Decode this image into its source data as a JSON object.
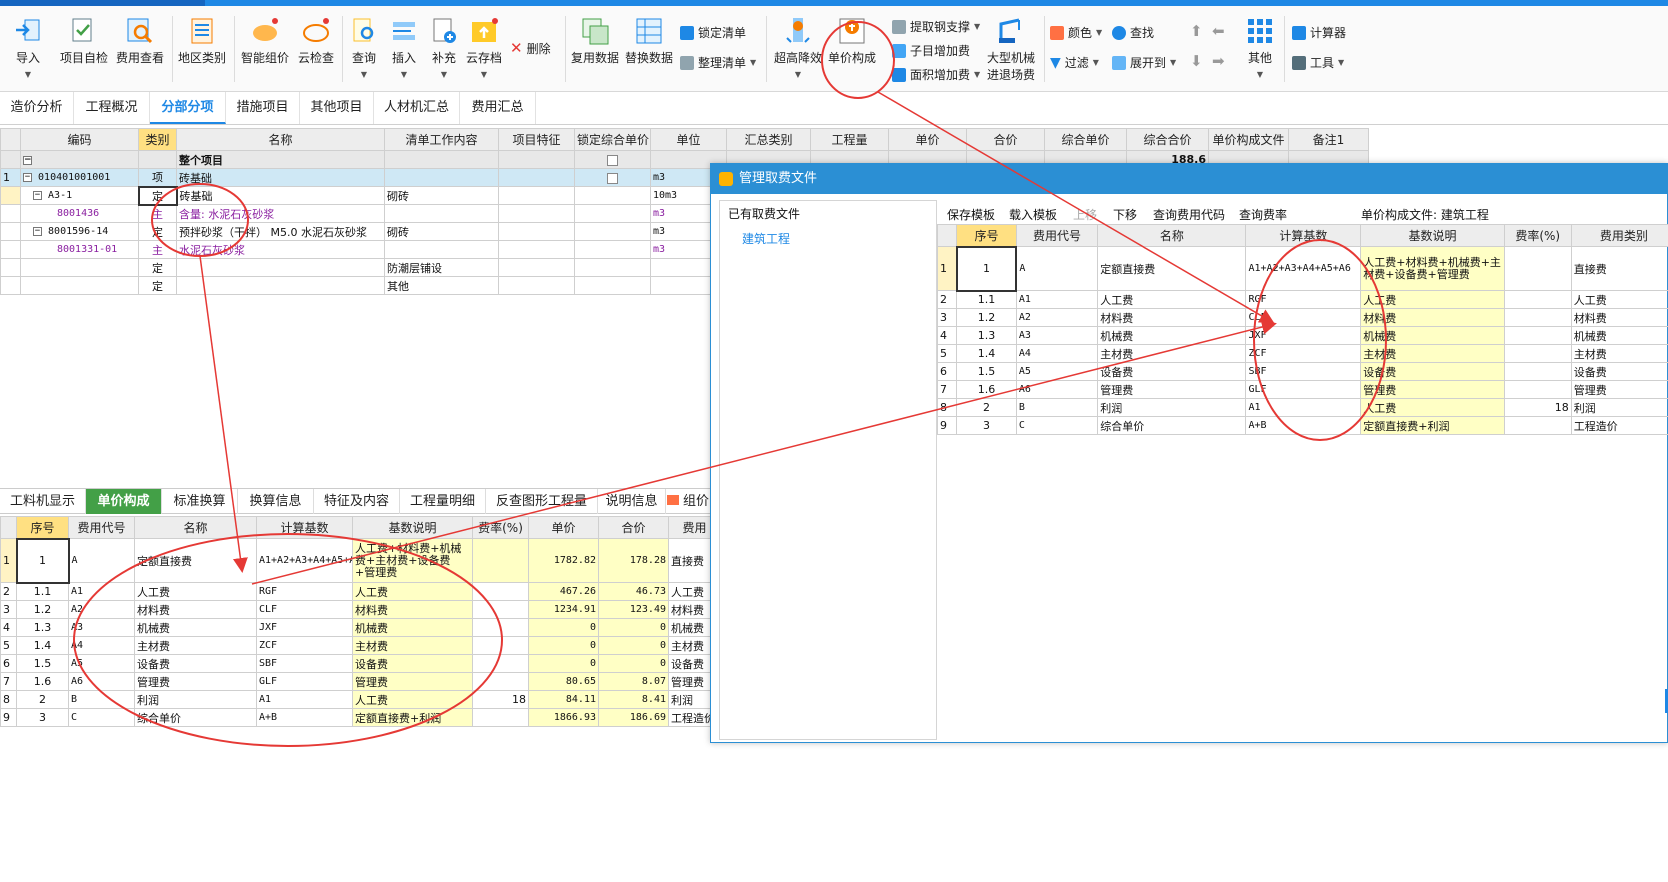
{
  "ribbon": {
    "import": "导入",
    "project_check": "项目自检",
    "fee_view": "费用查看",
    "region_type": "地区类别",
    "smart_price": "智能组价",
    "cloud_check": "云检查",
    "query": "查询",
    "insert": "插入",
    "supplement": "补充",
    "cloud_save": "云存档",
    "delete": "删除",
    "reuse_data": "复用数据",
    "replace_data": "替换数据",
    "lock_list": "锁定清单",
    "organize_list": "整理清单",
    "super_height": "超高降效",
    "unit_price_comp": "单价构成",
    "extract_steel": "提取钢支撑",
    "sub_add_fee": "子目增加费",
    "area_add_fee": "面积增加费",
    "large_machine_line1": "大型机械",
    "large_machine_line2": "进退场费",
    "color": "颜色",
    "find": "查找",
    "filter": "过滤",
    "expand_to": "展开到",
    "other": "其他",
    "calculator": "计算器",
    "tools": "工具"
  },
  "main_tabs": [
    "造价分析",
    "工程概况",
    "分部分项",
    "措施项目",
    "其他项目",
    "人材机汇总",
    "费用汇总"
  ],
  "main_grid": {
    "headers": [
      "编码",
      "类别",
      "名称",
      "清单工作内容",
      "项目特征",
      "锁定综合单价",
      "单位",
      "汇总类别",
      "工程量",
      "单价",
      "合价",
      "综合单价",
      "综合合价",
      "单价构成文件",
      "备注1"
    ],
    "total_label": "整个项目",
    "total_amount": "188.6",
    "rows": [
      {
        "num": "1",
        "code": "010401001001",
        "type": "项",
        "name": "砖基础",
        "content": "",
        "unit": "m3"
      },
      {
        "num": "",
        "code": "A3-1",
        "type": "定",
        "name": "砖基础",
        "content": "砌砖",
        "unit": "10m3"
      },
      {
        "num": "",
        "code": "8001436",
        "type": "主",
        "name": "含量: 水泥石灰砂浆",
        "content": "",
        "unit": "m3"
      },
      {
        "num": "",
        "code": "8001596-14",
        "type": "定",
        "name": "预拌砂浆（干拌） M5.0 水泥石灰砂浆",
        "content": "砌砖",
        "unit": "m3"
      },
      {
        "num": "",
        "code": "8001331-01",
        "type": "主",
        "name": "水泥石灰砂浆",
        "content": "",
        "unit": "m3"
      },
      {
        "num": "",
        "code": "",
        "type": "定",
        "name": "",
        "content": "防潮层铺设",
        "unit": ""
      },
      {
        "num": "",
        "code": "",
        "type": "定",
        "name": "",
        "content": "其他",
        "unit": ""
      }
    ]
  },
  "bottom_tabs": [
    "工料机显示",
    "单价构成",
    "标准换算",
    "换算信息",
    "特征及内容",
    "工程量明细",
    "反查图形工程量",
    "说明信息",
    "组价"
  ],
  "bottom_grid": {
    "headers": [
      "序号",
      "费用代号",
      "名称",
      "计算基数",
      "基数说明",
      "费率(%)",
      "单价",
      "合价",
      "费用"
    ],
    "rows": [
      {
        "num": "1",
        "seq": "1",
        "code": "A",
        "name": "定额直接费",
        "base": "A1+A2+A3+A4+A5+A6",
        "desc": "人工费+材料费+机械费+主材费+设备费+管理费",
        "rate": "",
        "price": "1782.82",
        "total": "178.28",
        "cat": "直接费"
      },
      {
        "num": "2",
        "seq": "1.1",
        "code": "A1",
        "name": "人工费",
        "base": "RGF",
        "desc": "人工费",
        "rate": "",
        "price": "467.26",
        "total": "46.73",
        "cat": "人工费"
      },
      {
        "num": "3",
        "seq": "1.2",
        "code": "A2",
        "name": "材料费",
        "base": "CLF",
        "desc": "材料费",
        "rate": "",
        "price": "1234.91",
        "total": "123.49",
        "cat": "材料费"
      },
      {
        "num": "4",
        "seq": "1.3",
        "code": "A3",
        "name": "机械费",
        "base": "JXF",
        "desc": "机械费",
        "rate": "",
        "price": "0",
        "total": "0",
        "cat": "机械费"
      },
      {
        "num": "5",
        "seq": "1.4",
        "code": "A4",
        "name": "主材费",
        "base": "ZCF",
        "desc": "主材费",
        "rate": "",
        "price": "0",
        "total": "0",
        "cat": "主材费"
      },
      {
        "num": "6",
        "seq": "1.5",
        "code": "A5",
        "name": "设备费",
        "base": "SBF",
        "desc": "设备费",
        "rate": "",
        "price": "0",
        "total": "0",
        "cat": "设备费"
      },
      {
        "num": "7",
        "seq": "1.6",
        "code": "A6",
        "name": "管理费",
        "base": "GLF",
        "desc": "管理费",
        "rate": "",
        "price": "80.65",
        "total": "8.07",
        "cat": "管理费"
      },
      {
        "num": "8",
        "seq": "2",
        "code": "B",
        "name": "利润",
        "base": "A1",
        "desc": "人工费",
        "rate": "18",
        "price": "84.11",
        "total": "8.41",
        "cat": "利润"
      },
      {
        "num": "9",
        "seq": "3",
        "code": "C",
        "name": "综合单价",
        "base": "A+B",
        "desc": "定额直接费+利润",
        "rate": "",
        "price": "1866.93",
        "total": "186.69",
        "cat": "工程造价"
      }
    ]
  },
  "dialog": {
    "title": "管理取费文件",
    "left_header": "已有取费文件",
    "left_item": "建筑工程",
    "toolbar": [
      "保存模板",
      "载入模板",
      "上移",
      "下移",
      "查询费用代码",
      "查询费率"
    ],
    "file_label": "单价构成文件: 建筑工程",
    "headers": [
      "序号",
      "费用代号",
      "名称",
      "计算基数",
      "基数说明",
      "费率(%)",
      "费用类别"
    ],
    "rows": [
      {
        "num": "1",
        "seq": "1",
        "code": "A",
        "name": "定额直接费",
        "base": "A1+A2+A3+A4+A5+A6",
        "desc": "人工费+材料费+机械费+主材费+设备费+管理费",
        "rate": "",
        "cat": "直接费"
      },
      {
        "num": "2",
        "seq": "1.1",
        "code": "A1",
        "name": "人工费",
        "base": "RGF",
        "desc": "人工费",
        "rate": "",
        "cat": "人工费"
      },
      {
        "num": "3",
        "seq": "1.2",
        "code": "A2",
        "name": "材料费",
        "base": "CLF",
        "desc": "材料费",
        "rate": "",
        "cat": "材料费"
      },
      {
        "num": "4",
        "seq": "1.3",
        "code": "A3",
        "name": "机械费",
        "base": "JXF",
        "desc": "机械费",
        "rate": "",
        "cat": "机械费"
      },
      {
        "num": "5",
        "seq": "1.4",
        "code": "A4",
        "name": "主材费",
        "base": "ZCF",
        "desc": "主材费",
        "rate": "",
        "cat": "主材费"
      },
      {
        "num": "6",
        "seq": "1.5",
        "code": "A5",
        "name": "设备费",
        "base": "SBF",
        "desc": "设备费",
        "rate": "",
        "cat": "设备费"
      },
      {
        "num": "7",
        "seq": "1.6",
        "code": "A6",
        "name": "管理费",
        "base": "GLF",
        "desc": "管理费",
        "rate": "",
        "cat": "管理费"
      },
      {
        "num": "8",
        "seq": "2",
        "code": "B",
        "name": "利润",
        "base": "A1",
        "desc": "人工费",
        "rate": "18",
        "cat": "利润"
      },
      {
        "num": "9",
        "seq": "3",
        "code": "C",
        "name": "综合单价",
        "base": "A+B",
        "desc": "定额直接费+利润",
        "rate": "",
        "cat": "工程造价"
      }
    ]
  },
  "colors": {
    "accent": "#1e88e5",
    "annotation": "#e53935",
    "active_tab_green": "#43a047",
    "highlight_yellow": "#ffffc5"
  }
}
